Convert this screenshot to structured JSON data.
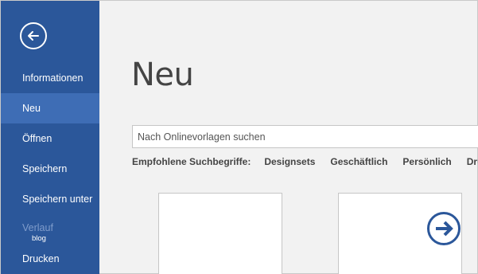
{
  "sidebar": {
    "back_icon": "back-arrow-icon",
    "items": [
      {
        "label": "Informationen"
      },
      {
        "label": "Neu"
      },
      {
        "label": "Öffnen"
      },
      {
        "label": "Speichern"
      },
      {
        "label": "Speichern unter"
      },
      {
        "label": "Verlauf"
      },
      {
        "label": "Drucken"
      }
    ],
    "sub_label": "blog",
    "active_index": 1
  },
  "main": {
    "title": "Neu",
    "search": {
      "placeholder": "Nach Onlinevorlagen suchen",
      "value": ""
    },
    "suggestions": {
      "label": "Empfohlene Suchbegriffe:",
      "links": [
        "Designsets",
        "Geschäftlich",
        "Persönlich",
        "Druck"
      ]
    },
    "templates": [
      {
        "icon": "blank-document-icon"
      },
      {
        "icon": "arrow-right-circle-icon"
      }
    ]
  },
  "colors": {
    "sidebar_bg": "#2b579a",
    "sidebar_active": "#3e6db5",
    "content_bg": "#f2f2f2",
    "accent_arrow": "#2b579a"
  }
}
